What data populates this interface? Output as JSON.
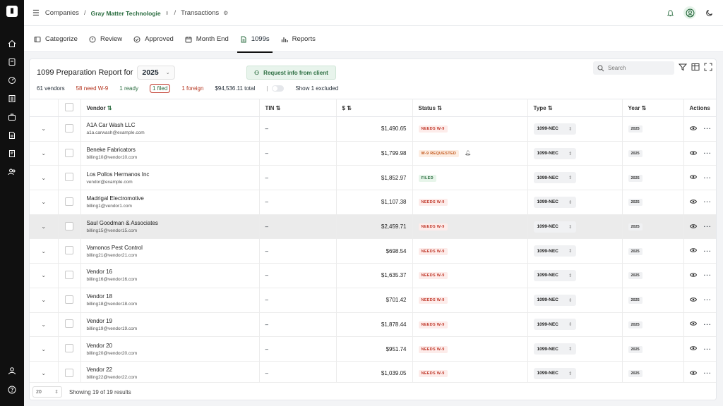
{
  "breadcrumb": {
    "companies": "Companies",
    "company": "Gray Matter Technologie",
    "section": "Transactions"
  },
  "tabs": [
    {
      "label": "Categorize",
      "icon": "categorize-icon"
    },
    {
      "label": "Review",
      "icon": "review-icon"
    },
    {
      "label": "Approved",
      "icon": "approved-icon"
    },
    {
      "label": "Month End",
      "icon": "calendar-icon"
    },
    {
      "label": "1099s",
      "icon": "document-icon",
      "active": true
    },
    {
      "label": "Reports",
      "icon": "chart-icon"
    }
  ],
  "report": {
    "title": "1099 Preparation Report for",
    "year": "2025",
    "request_label": "Request info from client",
    "search_placeholder": "Search"
  },
  "stats": {
    "vendors": "61 vendors",
    "need_w9": "58 need W-9",
    "ready": "1 ready",
    "filed": "1 filed",
    "foreign": "1 foreign",
    "total": "$94,536.11 total",
    "divider": "|",
    "excluded": "Show 1 excluded"
  },
  "columns": {
    "vendor": "Vendor",
    "tin": "TIN",
    "amount": "$",
    "status": "Status",
    "type": "Type",
    "year": "Year",
    "actions": "Actions"
  },
  "rows": [
    {
      "name": "A1A Car Wash LLC",
      "email": "a1a.carwash@example.com",
      "tin": "–",
      "amount": "$1,490.65",
      "status": "NEEDS W-9",
      "status_kind": "needs",
      "type": "1099-NEC",
      "year": "2025"
    },
    {
      "name": "Beneke Fabricators",
      "email": "billing10@vendor10.com",
      "tin": "–",
      "amount": "$1,799.98",
      "status": "W-9 REQUESTED",
      "status_kind": "req",
      "type": "1099-NEC",
      "year": "2025"
    },
    {
      "name": "Los Pollos Hermanos Inc",
      "email": "vendor@example.com",
      "tin": "–",
      "amount": "$1,852.97",
      "status": "FILED",
      "status_kind": "filed",
      "type": "1099-NEC",
      "year": "2025"
    },
    {
      "name": "Madrigal Electromotive",
      "email": "billing1@vendor1.com",
      "tin": "–",
      "amount": "$1,107.38",
      "status": "NEEDS W-9",
      "status_kind": "needs",
      "type": "1099-NEC",
      "year": "2025"
    },
    {
      "name": "Saul Goodman & Associates",
      "email": "billing15@vendor15.com",
      "tin": "–",
      "amount": "$2,459.71",
      "status": "NEEDS W-9",
      "status_kind": "needs",
      "type": "1099-NEC",
      "year": "2025",
      "highlight": true
    },
    {
      "name": "Vamonos Pest Control",
      "email": "billing21@vendor21.com",
      "tin": "–",
      "amount": "$698.54",
      "status": "NEEDS W-9",
      "status_kind": "needs",
      "type": "1099-NEC",
      "year": "2025"
    },
    {
      "name": "Vendor 16",
      "email": "billing16@vendor16.com",
      "tin": "–",
      "amount": "$1,635.37",
      "status": "NEEDS W-9",
      "status_kind": "needs",
      "type": "1099-NEC",
      "year": "2025"
    },
    {
      "name": "Vendor 18",
      "email": "billing18@vendor18.com",
      "tin": "–",
      "amount": "$701.42",
      "status": "NEEDS W-9",
      "status_kind": "needs",
      "type": "1099-NEC",
      "year": "2025"
    },
    {
      "name": "Vendor 19",
      "email": "billing19@vendor19.com",
      "tin": "–",
      "amount": "$1,878.44",
      "status": "NEEDS W-9",
      "status_kind": "needs",
      "type": "1099-NEC",
      "year": "2025"
    },
    {
      "name": "Vendor 20",
      "email": "billing20@vendor20.com",
      "tin": "–",
      "amount": "$951.74",
      "status": "NEEDS W-9",
      "status_kind": "needs",
      "type": "1099-NEC",
      "year": "2025"
    },
    {
      "name": "Vendor 22",
      "email": "billing22@vendor22.com",
      "tin": "–",
      "amount": "$1,039.05",
      "status": "NEEDS W-9",
      "status_kind": "needs",
      "type": "1099-NEC",
      "year": "2025"
    }
  ],
  "footer": {
    "page_size": "20",
    "results": "Showing 19 of 19 results"
  },
  "colors": {
    "accent_green": "#2b6d40",
    "needs_red": "#c0392b",
    "requested_orange": "#c2571a",
    "rail": "#101010"
  }
}
